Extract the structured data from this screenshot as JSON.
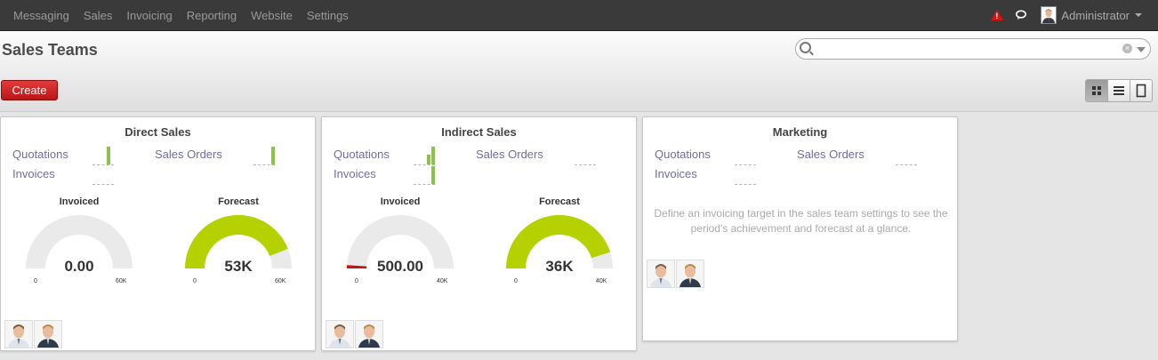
{
  "topbar": {
    "menu": [
      "Messaging",
      "Sales",
      "Invoicing",
      "Reporting",
      "Website",
      "Settings"
    ],
    "user": "Administrator"
  },
  "header": {
    "title": "Sales Teams",
    "search_placeholder": "",
    "create_label": "Create",
    "views": [
      "kanban",
      "list",
      "form"
    ],
    "active_view": "kanban"
  },
  "labels": {
    "quotations": "Quotations",
    "sales_orders": "Sales Orders",
    "invoices": "Invoices",
    "invoiced": "Invoiced",
    "forecast": "Forecast"
  },
  "teams": [
    {
      "name": "Direct Sales",
      "invoiced": {
        "value": "0.00",
        "min": "0",
        "max": "60K",
        "fraction": 0
      },
      "forecast": {
        "value": "53K",
        "min": "0",
        "max": "60K",
        "fraction": 0.88
      },
      "members": 2
    },
    {
      "name": "Indirect Sales",
      "invoiced": {
        "value": "500.00",
        "min": "0",
        "max": "40K",
        "fraction": 0.0125
      },
      "forecast": {
        "value": "36K",
        "min": "0",
        "max": "40K",
        "fraction": 0.9
      },
      "members": 2
    },
    {
      "name": "Marketing",
      "note": "Define an invoicing target in the sales team settings to see the period's achievement and forecast at a glance.",
      "members": 2
    }
  ],
  "colors": {
    "gauge_fill": "#b5d100",
    "gauge_track": "#eaeaea",
    "invoiced_fill": "#cc1111",
    "spark": "#8bc34a",
    "link": "#6c6ea6",
    "create": "#c62828"
  }
}
